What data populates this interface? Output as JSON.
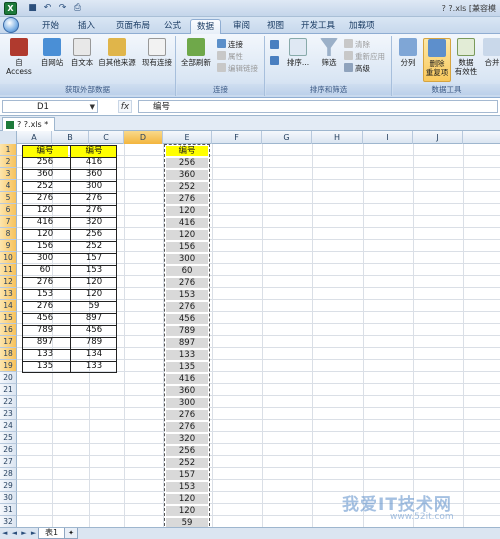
{
  "titlebar": {
    "title": "? ?.xls  [兼容模",
    "qat": [
      "save-icon",
      "undo-icon",
      "redo-icon",
      "print-preview-icon"
    ]
  },
  "ribbon_tabs": [
    {
      "label": "开始"
    },
    {
      "label": "插入"
    },
    {
      "label": "页面布局"
    },
    {
      "label": "公式"
    },
    {
      "label": "数据",
      "active": true
    },
    {
      "label": "审阅"
    },
    {
      "label": "视图"
    },
    {
      "label": "开发工具"
    },
    {
      "label": "加载项"
    }
  ],
  "ribbon": {
    "external": {
      "title": "获取外部数据",
      "access": "自 Access",
      "web": "自网站",
      "text": "自文本",
      "other": "自其他来源",
      "existing": "现有连接"
    },
    "connections": {
      "title": "连接",
      "refresh": "全部刷新",
      "conn": "连接",
      "props": "属性",
      "edit_links": "编辑链接"
    },
    "sortfilter": {
      "title": "排序和筛选",
      "sort": "排序...",
      "filter": "筛选",
      "clear": "清除",
      "reapply": "重新应用",
      "advanced": "高级"
    },
    "datatools": {
      "title": "数据工具",
      "split": "分列",
      "remove_dup_1": "删除",
      "remove_dup_2": "重复项",
      "validation_1": "数据",
      "validation_2": "有效性",
      "consolidate": "合并"
    }
  },
  "formula_bar": {
    "cell_ref": "D1",
    "fx": "fx",
    "content": "编号"
  },
  "workbook_tab": "? ?.xls *",
  "columns": [
    "A",
    "B",
    "C",
    "D",
    "E",
    "F",
    "G",
    "H",
    "I",
    "J"
  ],
  "rows": [
    "1",
    "2",
    "3",
    "4",
    "5",
    "6",
    "7",
    "8",
    "9",
    "10",
    "11",
    "12",
    "13",
    "14",
    "15",
    "16",
    "17",
    "18",
    "19",
    "20",
    "21",
    "22",
    "23",
    "24",
    "25",
    "26",
    "27",
    "28",
    "29",
    "30",
    "31",
    "32"
  ],
  "table_ab": {
    "header_a": "编号",
    "header_b": "编号",
    "rows": [
      [
        "256",
        "416"
      ],
      [
        "360",
        "360"
      ],
      [
        "252",
        "300"
      ],
      [
        "276",
        "276"
      ],
      [
        "120",
        "276"
      ],
      [
        "416",
        "320"
      ],
      [
        "120",
        "256"
      ],
      [
        "156",
        "252"
      ],
      [
        "300",
        "157"
      ],
      [
        "60",
        "153"
      ],
      [
        "276",
        "120"
      ],
      [
        "153",
        "120"
      ],
      [
        "276",
        "59"
      ],
      [
        "456",
        "897"
      ],
      [
        "789",
        "456"
      ],
      [
        "897",
        "789"
      ],
      [
        "133",
        "134"
      ],
      [
        "135",
        "133"
      ]
    ]
  },
  "column_d": {
    "header": "编号",
    "values": [
      "256",
      "360",
      "252",
      "276",
      "120",
      "416",
      "120",
      "156",
      "300",
      "60",
      "276",
      "153",
      "276",
      "456",
      "789",
      "897",
      "133",
      "135",
      "416",
      "360",
      "300",
      "276",
      "276",
      "320",
      "256",
      "252",
      "157",
      "153",
      "120",
      "120",
      "59"
    ]
  },
  "sheet_tabs": {
    "nav": "◄ ◄ ► ►",
    "active": "表1"
  },
  "watermark": {
    "text": "我爱IT技术网",
    "sub": "www.52it.com"
  }
}
